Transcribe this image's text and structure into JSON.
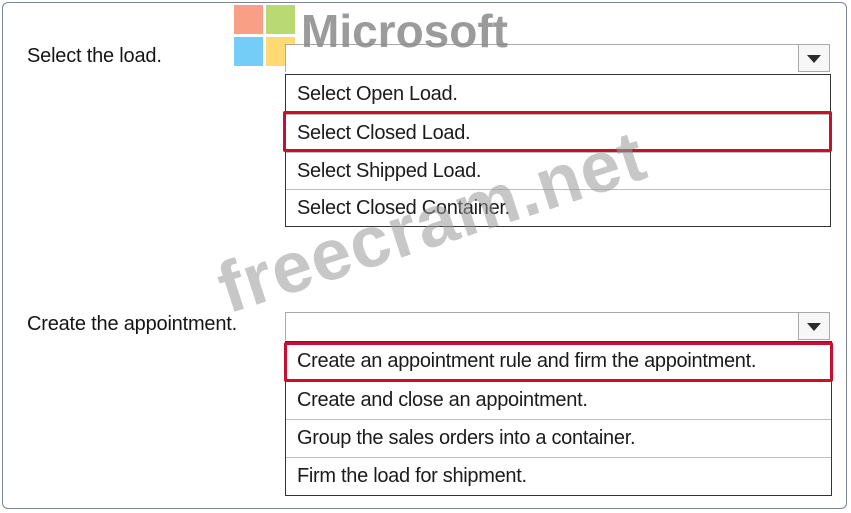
{
  "watermarks": {
    "brand_text": "Microsoft",
    "site_text": "freecram.net",
    "logo_colors": [
      "#f25022",
      "#7fba00",
      "#00a4ef",
      "#ffb900"
    ]
  },
  "questions": [
    {
      "label": "Select the load.",
      "selected_value": "",
      "options": [
        {
          "label": "Select Open Load."
        },
        {
          "label": "Select Closed Load."
        },
        {
          "label": "Select Shipped Load."
        },
        {
          "label": "Select Closed Container."
        }
      ],
      "highlighted_option_index": 1
    },
    {
      "label": "Create the appointment.",
      "selected_value": "",
      "options": [
        {
          "label": "Create an appointment rule and firm the appointment."
        },
        {
          "label": "Create and close an appointment."
        },
        {
          "label": "Group the sales orders into a container."
        },
        {
          "label": "Firm the load for shipment."
        }
      ],
      "highlighted_option_index": 0
    }
  ],
  "colors": {
    "highlight": "#c8102e",
    "list_border": "#333333"
  }
}
